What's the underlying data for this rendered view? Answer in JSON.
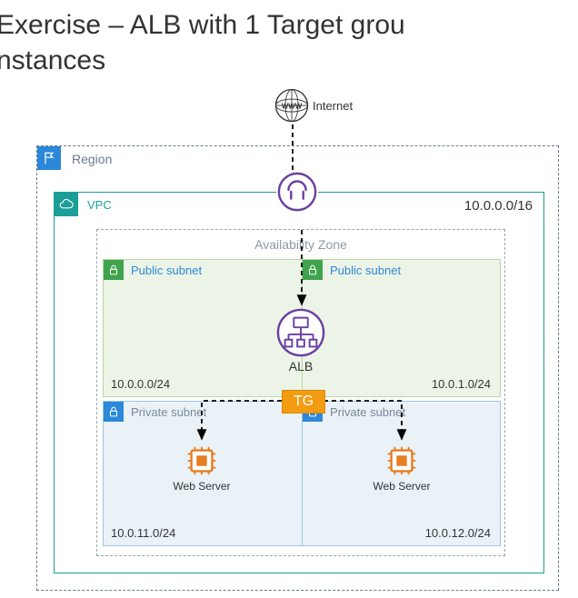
{
  "title_line1": "Exercise  – ALB with 1 Target grou",
  "title_line2": "nstances",
  "internet_label": "Internet",
  "region_label": "Region",
  "vpc": {
    "label": "VPC",
    "cidr": "10.0.0.0/16"
  },
  "az_label": "Availability Zone",
  "subnets": {
    "public_left": {
      "label": "Public subnet",
      "cidr": "10.0.0.0/24"
    },
    "public_right": {
      "label": "Public subnet",
      "cidr": "10.0.1.0/24"
    },
    "private_left": {
      "label": "Private subnet",
      "cidr": "10.0.11.0/24"
    },
    "private_right": {
      "label": "Private subnet",
      "cidr": "10.0.12.0/24"
    }
  },
  "alb_label": "ALB",
  "tg_label": "TG",
  "server_label": "Web Server"
}
